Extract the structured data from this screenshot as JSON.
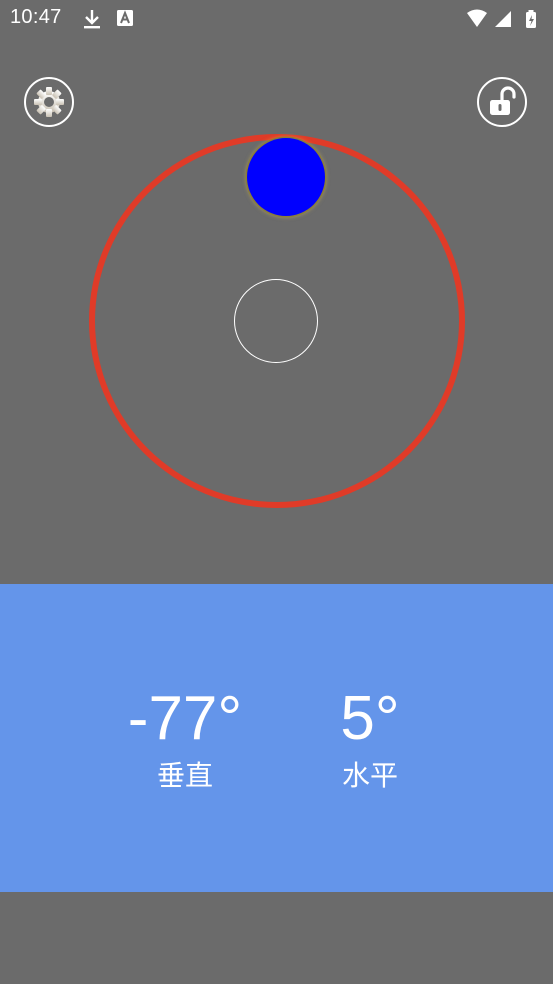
{
  "status_bar": {
    "time": "10:47",
    "left_icons": [
      "download-icon",
      "a-badge-icon"
    ],
    "right_icons": [
      "wifi-icon",
      "signal-icon",
      "battery-icon"
    ]
  },
  "toolbar": {
    "settings_icon": "gear-icon",
    "lock_icon": "unlocked-padlock-icon"
  },
  "level": {
    "ring_color": "#e03b28",
    "bubble_color": "#0000ff",
    "center_color": "#ffffff"
  },
  "readout": {
    "vertical": {
      "value": "-77°",
      "label": "垂直"
    },
    "horizontal": {
      "value": "5°",
      "label": "水平"
    }
  },
  "colors": {
    "background": "#6b6b6b",
    "panel": "#6495ea",
    "text": "#ffffff"
  }
}
